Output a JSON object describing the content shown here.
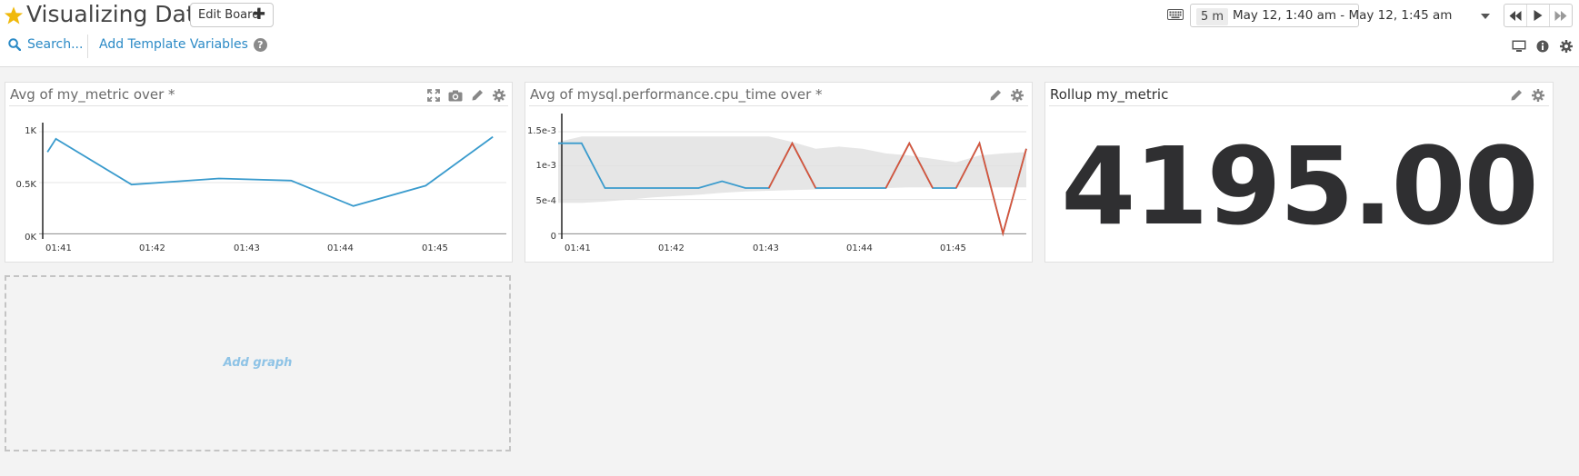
{
  "header": {
    "title": "Visualizing Data",
    "edit_board_label": "Edit Board",
    "search_label": "Search...",
    "template_vars_label": "Add Template Variables",
    "time_span": "5 m",
    "time_range": "May 12, 1:40 am - May 12, 1:45 am",
    "icons": [
      "star-icon",
      "plus-icon",
      "search-icon",
      "help-icon",
      "keyboard-icon",
      "rewind-icon",
      "play-icon",
      "fast-forward-icon",
      "monitor-icon",
      "info-icon",
      "gear-icon"
    ]
  },
  "colors": {
    "accent": "#2b8ac6",
    "series": "#3a9bcd",
    "anomaly": "#d9553a",
    "band": "#e6e6e6",
    "star": "#f0b90b"
  },
  "widgets": [
    {
      "title": "Avg of my_metric over *",
      "icons": [
        "expand-icon",
        "camera-icon",
        "pencil-icon",
        "gear-icon"
      ],
      "chart_data": {
        "type": "line",
        "x": [
          "01:40:55",
          "01:41:00",
          "01:41:45",
          "01:42:37",
          "01:43:20",
          "01:43:57",
          "01:44:40",
          "01:45:20"
        ],
        "series": [
          {
            "values": [
              800,
              930,
              480,
              540,
              520,
              270,
              470,
              950
            ]
          }
        ],
        "ylim": [
          0,
          1000
        ],
        "y_ticks": [
          "1K",
          "0.5K",
          "0K"
        ],
        "x_ticks": [
          "01:41",
          "01:42",
          "01:43",
          "01:44",
          "01:45"
        ],
        "grid": true
      }
    },
    {
      "title": "Avg of mysql.performance.cpu_time over *",
      "icons": [
        "pencil-icon",
        "gear-icon"
      ],
      "chart_data": {
        "type": "line",
        "x_ticks": [
          "01:41",
          "01:42",
          "01:43",
          "01:44",
          "01:45"
        ],
        "y_ticks": [
          "1.5e-3",
          "1e-3",
          "5e-4",
          "0"
        ],
        "ylim": [
          0,
          0.0015
        ],
        "series": [
          {
            "values": [
              0.00133,
              0.00133,
              0.00067,
              0.00067,
              0.00067,
              0.00067,
              0.00067,
              0.00077,
              0.00067,
              0.00067,
              0.00133,
              0.00067,
              0.00067,
              0.00067,
              0.00067,
              0.00133,
              0.00067,
              0.00067,
              0.00133,
              0.0,
              0.00125
            ]
          },
          {
            "values": [
              0.00133,
              0.00133,
              0.00067,
              0.00067,
              0.00067,
              0.00067,
              0.00067,
              0.00077,
              0.00067,
              0.00067,
              0.00133,
              0.00067,
              0.00067,
              0.00067,
              0.00067,
              0.00133,
              0.00067,
              0.00067,
              0.00133,
              0.0,
              0.00125
            ]
          }
        ],
        "anomaly_segments": [
          [
            9,
            11
          ],
          [
            14,
            16
          ],
          [
            17,
            20
          ]
        ],
        "band_upper": [
          0.00135,
          0.00143,
          0.00143,
          0.00143,
          0.00143,
          0.00143,
          0.00143,
          0.00143,
          0.00143,
          0.00143,
          0.00135,
          0.00125,
          0.00128,
          0.00125,
          0.00118,
          0.00115,
          0.0011,
          0.00105,
          0.00115,
          0.00118,
          0.0012
        ],
        "band_lower": [
          0.00045,
          0.00045,
          0.00047,
          0.0005,
          0.00053,
          0.00055,
          0.00057,
          0.0006,
          0.00062,
          0.00063,
          0.00064,
          0.00065,
          0.00066,
          0.00067,
          0.00067,
          0.00068,
          0.00068,
          0.00068,
          0.00068,
          0.00068,
          0.00068
        ],
        "grid": true
      }
    },
    {
      "title": "Rollup my_metric",
      "icons": [
        "pencil-icon",
        "gear-icon"
      ],
      "value": "4195.00"
    }
  ],
  "add_graph_label": "Add graph"
}
